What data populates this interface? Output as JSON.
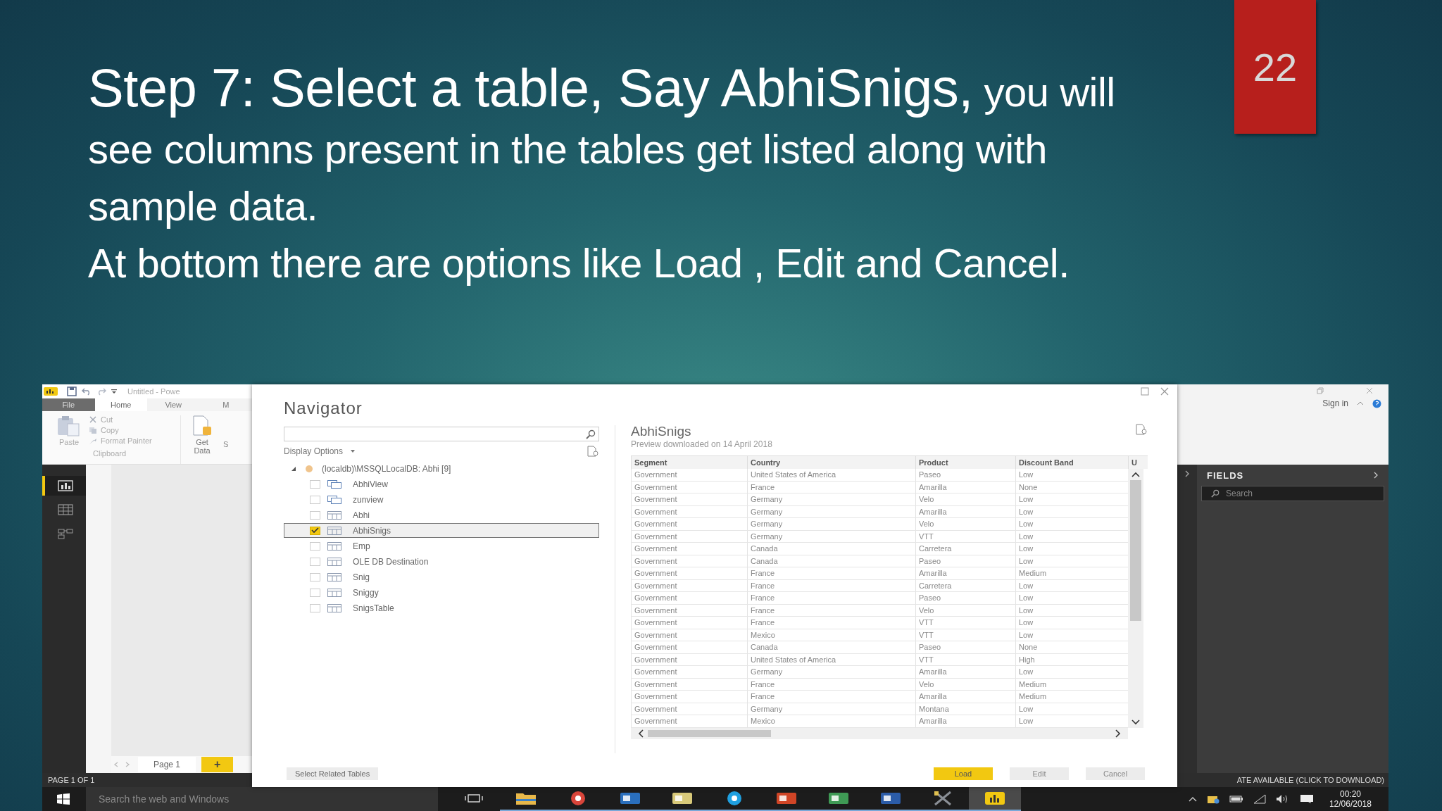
{
  "slide": {
    "page_number": "22",
    "heading_lead": "Step 7: Select a table, Say AbhiSnigs,",
    "heading_rest": "you will see columns present in the tables get listed along with sample data.",
    "paragraph": "At bottom there are options like Load , Edit and Cancel."
  },
  "app": {
    "title": "Untitled - Powe",
    "file_tab": "File",
    "tabs": [
      {
        "label": "Home",
        "selected": true
      },
      {
        "label": "View",
        "selected": false
      },
      {
        "label": "M",
        "selected": false
      }
    ],
    "ribbon": {
      "paste": "Paste",
      "cut": "Cut",
      "copy": "Copy",
      "format_painter": "Format Painter",
      "group": "Clipboard",
      "get_data": "Get Data",
      "next": "S"
    },
    "views": [
      {
        "kind": "report",
        "selected": true
      },
      {
        "kind": "data",
        "selected": false
      },
      {
        "kind": "model",
        "selected": false
      }
    ],
    "page_tab": "Page 1",
    "add_page": "+",
    "status": "PAGE 1 OF 1",
    "sign_in": "Sign in",
    "fields_title": "FIELDS",
    "fields_search_placeholder": "Search",
    "update_notice": "ATE AVAILABLE (CLICK TO DOWNLOAD)"
  },
  "navigator": {
    "title": "Navigator",
    "display_options": "Display Options",
    "source": {
      "label": "(localdb)\\MSSQLLocalDB: Abhi [9]",
      "expanded": true,
      "children": [
        {
          "label": "AbhiView",
          "kind": "view",
          "checked": false,
          "selected": false
        },
        {
          "label": "zunview",
          "kind": "view",
          "checked": false,
          "selected": false
        },
        {
          "label": "Abhi",
          "kind": "table",
          "checked": false,
          "selected": false
        },
        {
          "label": "AbhiSnigs",
          "kind": "table",
          "checked": true,
          "selected": true
        },
        {
          "label": "Emp",
          "kind": "table",
          "checked": false,
          "selected": false
        },
        {
          "label": "OLE DB Destination",
          "kind": "table",
          "checked": false,
          "selected": false
        },
        {
          "label": "Snig",
          "kind": "table",
          "checked": false,
          "selected": false
        },
        {
          "label": "Sniggy",
          "kind": "table",
          "checked": false,
          "selected": false
        },
        {
          "label": "SnigsTable",
          "kind": "table",
          "checked": false,
          "selected": false
        }
      ]
    },
    "preview": {
      "title": "AbhiSnigs",
      "subtitle": "Preview downloaded on 14 April 2018",
      "columns": [
        "Segment",
        "Country",
        "Product",
        "Discount Band",
        "U"
      ],
      "rows": [
        [
          "Government",
          "United States of America",
          "Paseo",
          "Low"
        ],
        [
          "Government",
          "France",
          "Amarilla",
          "None"
        ],
        [
          "Government",
          "Germany",
          "Velo",
          "Low"
        ],
        [
          "Government",
          "Germany",
          "Amarilla",
          "Low"
        ],
        [
          "Government",
          "Germany",
          "Velo",
          "Low"
        ],
        [
          "Government",
          "Germany",
          "VTT",
          "Low"
        ],
        [
          "Government",
          "Canada",
          "Carretera",
          "Low"
        ],
        [
          "Government",
          "Canada",
          "Paseo",
          "Low"
        ],
        [
          "Government",
          "France",
          "Amarilla",
          "Medium"
        ],
        [
          "Government",
          "France",
          "Carretera",
          "Low"
        ],
        [
          "Government",
          "France",
          "Paseo",
          "Low"
        ],
        [
          "Government",
          "France",
          "Velo",
          "Low"
        ],
        [
          "Government",
          "France",
          "VTT",
          "Low"
        ],
        [
          "Government",
          "Mexico",
          "VTT",
          "Low"
        ],
        [
          "Government",
          "Canada",
          "Paseo",
          "None"
        ],
        [
          "Government",
          "United States of America",
          "VTT",
          "High"
        ],
        [
          "Government",
          "Germany",
          "Amarilla",
          "Low"
        ],
        [
          "Government",
          "France",
          "Velo",
          "Medium"
        ],
        [
          "Government",
          "France",
          "Amarilla",
          "Medium"
        ],
        [
          "Government",
          "Germany",
          "Montana",
          "Low"
        ],
        [
          "Government",
          "Mexico",
          "Amarilla",
          "Low"
        ]
      ]
    },
    "select_related": "Select Related Tables",
    "buttons": [
      {
        "label": "Load",
        "kind": "primary"
      },
      {
        "label": "Edit",
        "kind": "secondary"
      },
      {
        "label": "Cancel",
        "kind": "secondary"
      }
    ]
  },
  "taskbar": {
    "search_placeholder": "Search the web and Windows",
    "apps": [
      {
        "kind": "taskview",
        "selected": false
      },
      {
        "kind": "folder",
        "selected": false
      },
      {
        "kind": "chrome",
        "selected": false
      },
      {
        "kind": "outlook",
        "selected": false
      },
      {
        "kind": "notes",
        "selected": false
      },
      {
        "kind": "skype",
        "selected": false
      },
      {
        "kind": "powerpoint",
        "selected": false
      },
      {
        "kind": "excel",
        "selected": false
      },
      {
        "kind": "word",
        "selected": false
      },
      {
        "kind": "tools",
        "selected": false
      },
      {
        "kind": "powerbi",
        "selected": true
      }
    ],
    "time": "00:20",
    "date": "12/06/2018"
  }
}
